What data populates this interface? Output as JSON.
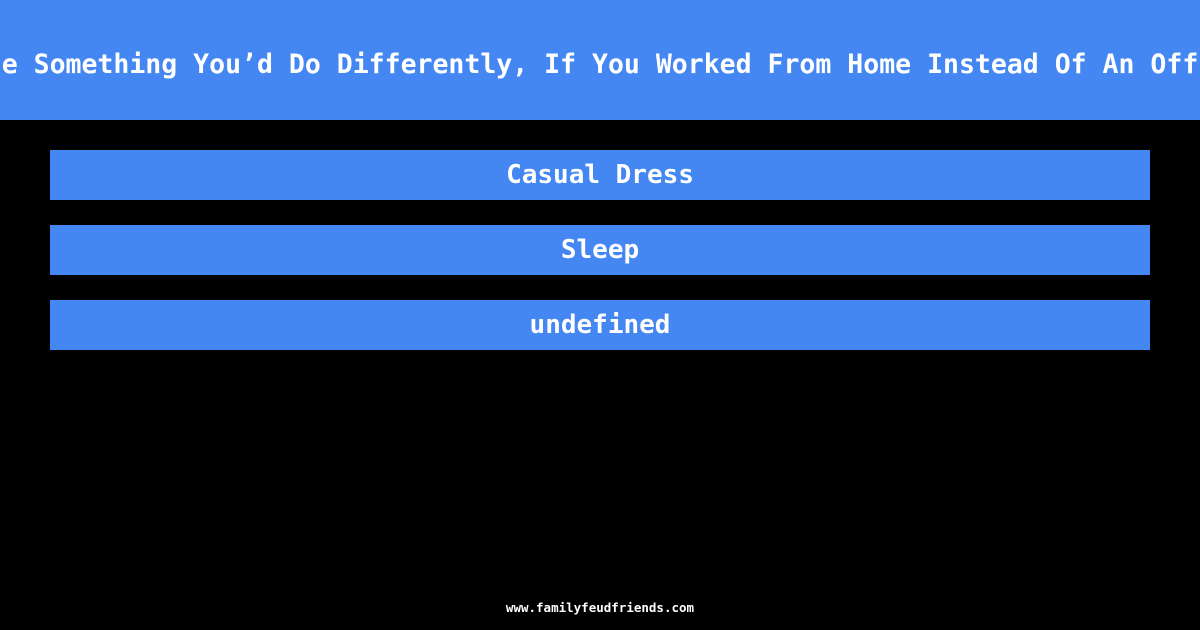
{
  "header": {
    "question_visible": "e Something You’d Do Differently, If You Worked From Home Instead Of An Off"
  },
  "answers": [
    {
      "label": "Casual Dress"
    },
    {
      "label": "Sleep"
    },
    {
      "label": "undefined"
    }
  ],
  "footer": {
    "site": "www.familyfeudfriends.com"
  },
  "colors": {
    "accent": "#4487F2",
    "background": "#000000",
    "text": "#FFFFFF"
  }
}
